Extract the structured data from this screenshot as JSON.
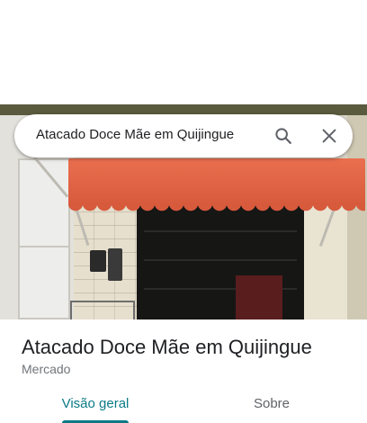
{
  "search": {
    "query": "Atacado Doce Mãe em Quijingue",
    "search_icon": "search-icon",
    "close_icon": "close-icon"
  },
  "place": {
    "title": "Atacado Doce Mãe em Quijingue",
    "category": "Mercado"
  },
  "tabs": [
    {
      "label": "Visão geral",
      "selected": true
    },
    {
      "label": "Sobre",
      "selected": false
    }
  ],
  "colors": {
    "accent": "#0b7a86",
    "awning": "#e2654a"
  }
}
